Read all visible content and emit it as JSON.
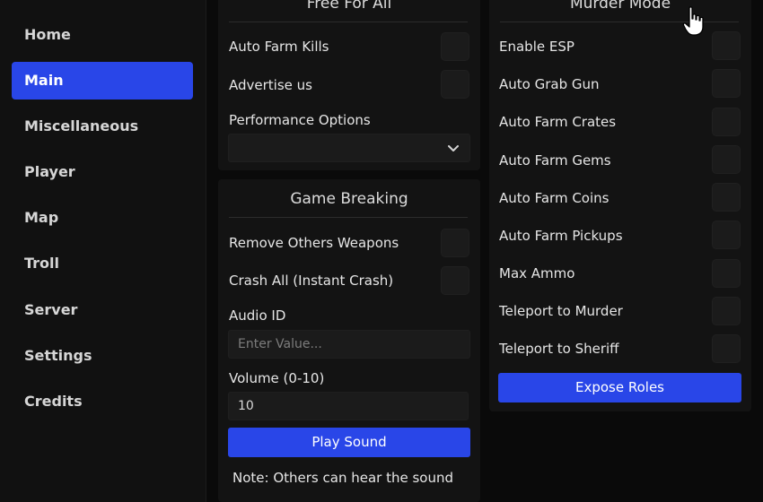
{
  "sidebar": {
    "items": [
      {
        "label": "Home",
        "active": false
      },
      {
        "label": "Main",
        "active": true
      },
      {
        "label": "Miscellaneous",
        "active": false
      },
      {
        "label": "Player",
        "active": false
      },
      {
        "label": "Map",
        "active": false
      },
      {
        "label": "Troll",
        "active": false
      },
      {
        "label": "Server",
        "active": false
      },
      {
        "label": "Settings",
        "active": false
      },
      {
        "label": "Credits",
        "active": false
      }
    ]
  },
  "free_for_all": {
    "title": "Free For All",
    "toggles": [
      {
        "label": "Auto Farm Kills",
        "on": false
      },
      {
        "label": "Advertise us",
        "on": false
      }
    ],
    "dropdown_label": "Performance Options",
    "dropdown_value": ""
  },
  "game_breaking": {
    "title": "Game Breaking",
    "toggles": [
      {
        "label": "Remove Others Weapons",
        "on": false
      },
      {
        "label": "Crash All (Instant Crash)",
        "on": false
      }
    ],
    "audio_label": "Audio ID",
    "audio_placeholder": "Enter Value...",
    "audio_value": "",
    "volume_label": "Volume (0-10)",
    "volume_value": "10",
    "play_button": "Play Sound",
    "note": "Note: Others can hear the sound"
  },
  "murder_mode": {
    "title": "Murder Mode",
    "toggles": [
      {
        "label": "Enable ESP",
        "on": false
      },
      {
        "label": "Auto Grab Gun",
        "on": false
      },
      {
        "label": "Auto Farm Crates",
        "on": false
      },
      {
        "label": "Auto Farm Gems",
        "on": false
      },
      {
        "label": "Auto Farm Coins",
        "on": false
      },
      {
        "label": "Auto Farm Pickups",
        "on": false
      },
      {
        "label": "Max Ammo",
        "on": false
      },
      {
        "label": "Teleport to Murder",
        "on": false
      },
      {
        "label": "Teleport to Sheriff",
        "on": false
      }
    ],
    "expose_button": "Expose Roles"
  },
  "colors": {
    "accent": "#2946e8",
    "background": "#0a0a0a",
    "panel": "#131313",
    "sidebar": "#111111"
  },
  "icons": {
    "dropdown": "chevron-down-icon",
    "cursor": "hand-pointer-icon"
  }
}
